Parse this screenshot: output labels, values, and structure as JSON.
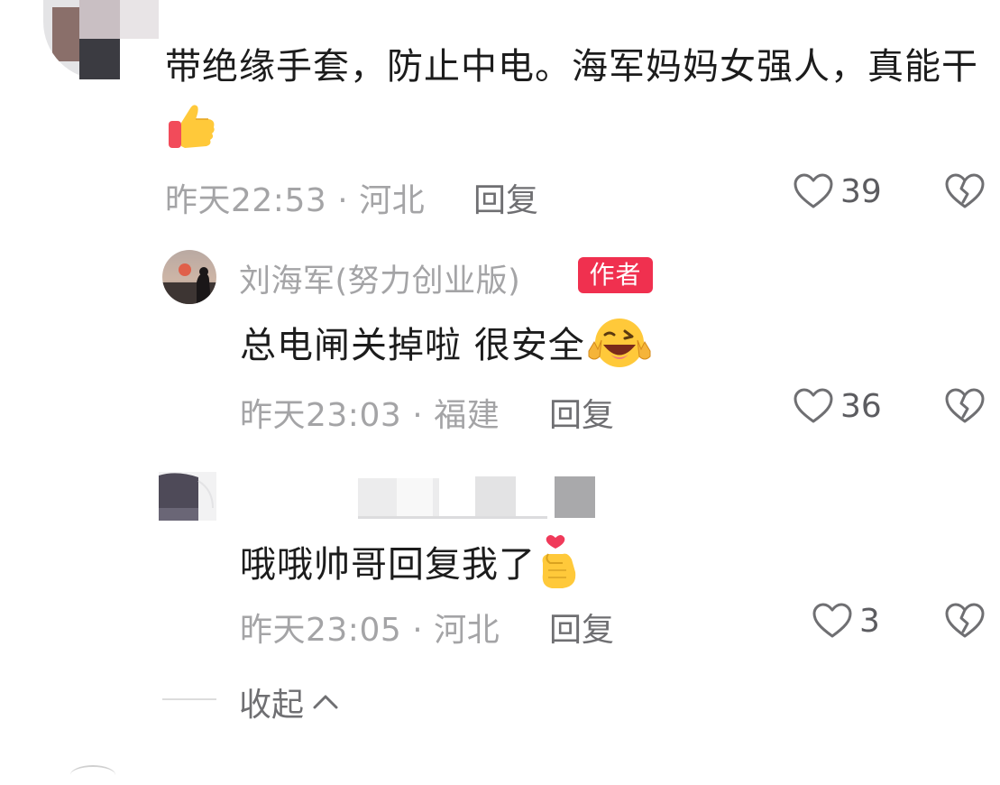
{
  "comments": {
    "top": {
      "text": "带绝缘手套，防止中电。海军妈妈女强人，真能干",
      "time": "昨天22:53",
      "location": "河北",
      "reply_label": "回复",
      "likes": "39",
      "emoji": "thumbs-up-emoji"
    },
    "reply1": {
      "author": "刘海军(努力创业版)",
      "badge": "作者",
      "text": "总电闸关掉啦 很安全",
      "emoji": "winking-grin-emoji",
      "time": "昨天23:03",
      "location": "福建",
      "reply_label": "回复",
      "likes": "36"
    },
    "reply2": {
      "author": "",
      "text": "哦哦帅哥回复我了",
      "emoji": "finger-heart-emoji",
      "time": "昨天23:05",
      "location": "河北",
      "reply_label": "回复",
      "likes": "3"
    }
  },
  "collapse_label": "收起",
  "separator": "·",
  "colors": {
    "badge_bg": "#f0304f",
    "meta_text": "#a4a4a6",
    "body_text": "#1c1c1c",
    "icon_stroke": "#6f6f72"
  },
  "icons": [
    "heart-outline-icon",
    "broken-heart-icon",
    "chevron-up-icon"
  ]
}
